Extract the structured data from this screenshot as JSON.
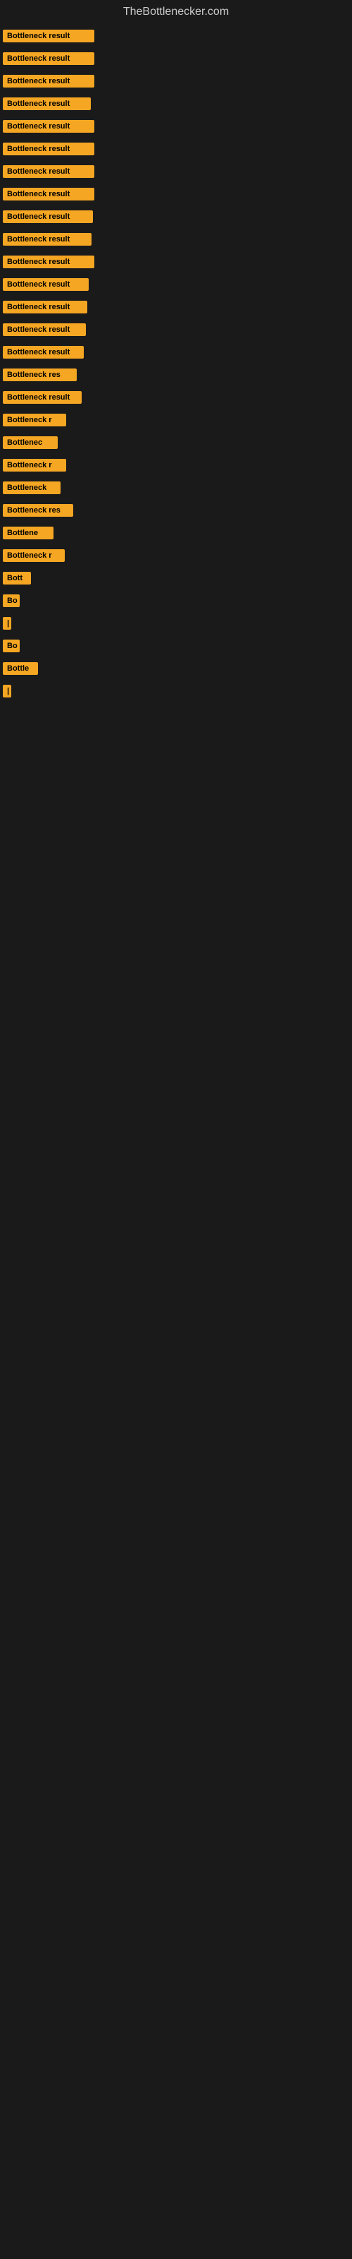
{
  "site": {
    "title": "TheBottlenecker.com"
  },
  "items": [
    {
      "label": "Bottleneck result",
      "width": 130
    },
    {
      "label": "Bottleneck result",
      "width": 130
    },
    {
      "label": "Bottleneck result",
      "width": 130
    },
    {
      "label": "Bottleneck result",
      "width": 125
    },
    {
      "label": "Bottleneck result",
      "width": 130
    },
    {
      "label": "Bottleneck result",
      "width": 130
    },
    {
      "label": "Bottleneck result",
      "width": 130
    },
    {
      "label": "Bottleneck result",
      "width": 130
    },
    {
      "label": "Bottleneck result",
      "width": 128
    },
    {
      "label": "Bottleneck result",
      "width": 126
    },
    {
      "label": "Bottleneck result",
      "width": 130
    },
    {
      "label": "Bottleneck result",
      "width": 122
    },
    {
      "label": "Bottleneck result",
      "width": 120
    },
    {
      "label": "Bottleneck result",
      "width": 118
    },
    {
      "label": "Bottleneck result",
      "width": 115
    },
    {
      "label": "Bottleneck res",
      "width": 105
    },
    {
      "label": "Bottleneck result",
      "width": 112
    },
    {
      "label": "Bottleneck r",
      "width": 90
    },
    {
      "label": "Bottlenec",
      "width": 78
    },
    {
      "label": "Bottleneck r",
      "width": 90
    },
    {
      "label": "Bottleneck",
      "width": 82
    },
    {
      "label": "Bottleneck res",
      "width": 100
    },
    {
      "label": "Bottlene",
      "width": 72
    },
    {
      "label": "Bottleneck r",
      "width": 88
    },
    {
      "label": "Bott",
      "width": 40
    },
    {
      "label": "Bo",
      "width": 24
    },
    {
      "label": "|",
      "width": 8
    },
    {
      "label": "Bo",
      "width": 24
    },
    {
      "label": "Bottle",
      "width": 50
    },
    {
      "label": "|",
      "width": 8
    }
  ],
  "colors": {
    "badge_bg": "#f5a623",
    "badge_text": "#000000",
    "page_bg": "#1a1a1a",
    "title_color": "#cccccc"
  }
}
